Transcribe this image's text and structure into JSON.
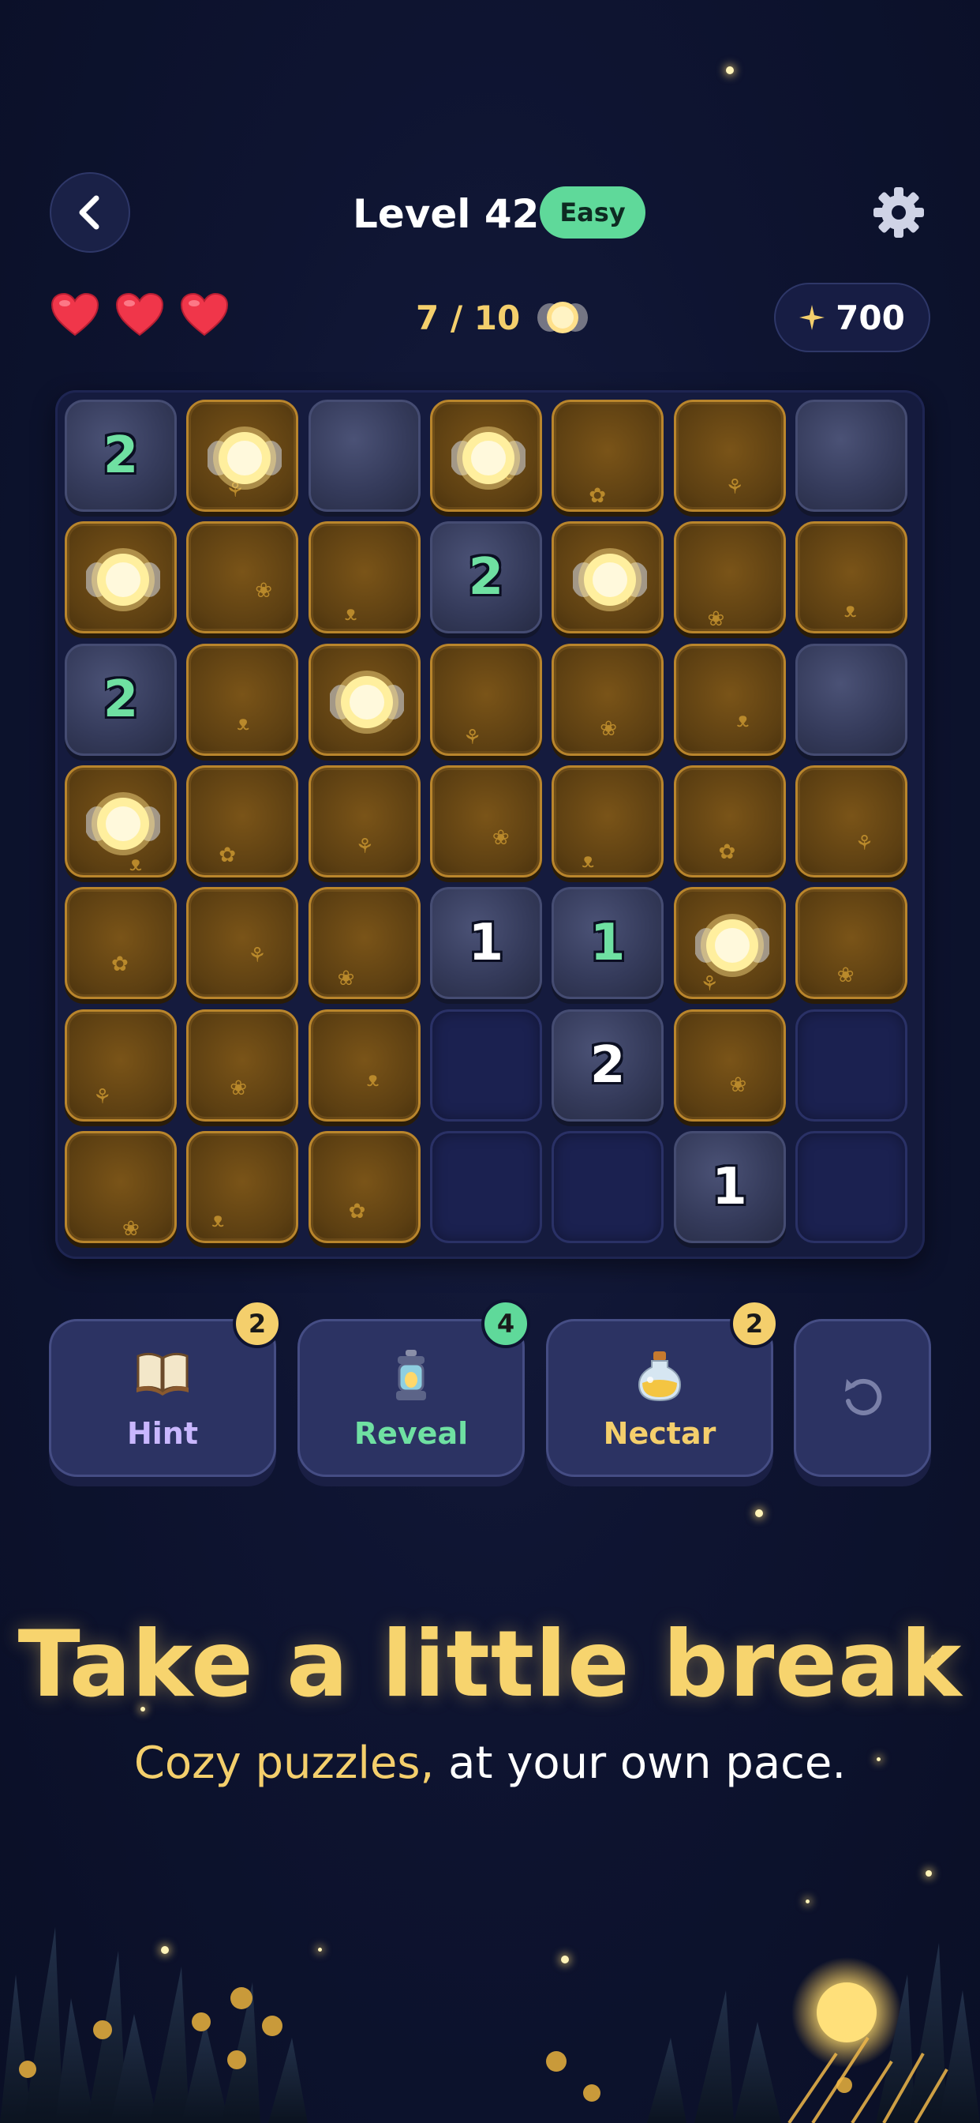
{
  "header": {
    "back_icon": "chevron-left-icon",
    "title": "Level 42",
    "difficulty": "Easy",
    "settings_icon": "gear-icon"
  },
  "status": {
    "lives": 3,
    "progress": "7 / 10",
    "coins": "700"
  },
  "board": {
    "rows": [
      [
        {
          "t": "stone",
          "n": "2",
          "c": "g"
        },
        {
          "t": "glow"
        },
        {
          "t": "stone"
        },
        {
          "t": "glow"
        },
        {
          "t": "dirt"
        },
        {
          "t": "dirt"
        },
        {
          "t": "stone"
        }
      ],
      [
        {
          "t": "glow"
        },
        {
          "t": "dirt"
        },
        {
          "t": "dirt"
        },
        {
          "t": "stone",
          "n": "2",
          "c": "g"
        },
        {
          "t": "glow"
        },
        {
          "t": "dirt"
        },
        {
          "t": "dirt"
        }
      ],
      [
        {
          "t": "stone",
          "n": "2",
          "c": "g"
        },
        {
          "t": "dirt"
        },
        {
          "t": "glow"
        },
        {
          "t": "dirt"
        },
        {
          "t": "dirt"
        },
        {
          "t": "dirt"
        },
        {
          "t": "stone"
        }
      ],
      [
        {
          "t": "glow"
        },
        {
          "t": "dirt"
        },
        {
          "t": "dirt"
        },
        {
          "t": "dirt"
        },
        {
          "t": "dirt"
        },
        {
          "t": "dirt"
        },
        {
          "t": "dirt"
        }
      ],
      [
        {
          "t": "dirt"
        },
        {
          "t": "dirt"
        },
        {
          "t": "dirt"
        },
        {
          "t": "stone",
          "n": "1",
          "c": "w"
        },
        {
          "t": "stone",
          "n": "1",
          "c": "g"
        },
        {
          "t": "glow"
        },
        {
          "t": "dirt"
        }
      ],
      [
        {
          "t": "dirt"
        },
        {
          "t": "dirt"
        },
        {
          "t": "dirt"
        },
        {
          "t": "empty"
        },
        {
          "t": "stone",
          "n": "2",
          "c": "w"
        },
        {
          "t": "dirt"
        },
        {
          "t": "empty"
        }
      ],
      [
        {
          "t": "dirt"
        },
        {
          "t": "dirt"
        },
        {
          "t": "dirt"
        },
        {
          "t": "empty"
        },
        {
          "t": "empty"
        },
        {
          "t": "stone",
          "n": "1",
          "c": "w"
        },
        {
          "t": "empty"
        }
      ]
    ]
  },
  "powerups": [
    {
      "label": "Hint",
      "count": "2",
      "icon": "book-icon",
      "label_color": "#c9b7ff",
      "badge_color": "#f4cf6c"
    },
    {
      "label": "Reveal",
      "count": "4",
      "icon": "lantern-icon",
      "label_color": "#6fe0a2",
      "badge_color": "#5fd99a"
    },
    {
      "label": "Nectar",
      "count": "2",
      "icon": "potion-icon",
      "label_color": "#f4cf6c",
      "badge_color": "#f4cf6c"
    }
  ],
  "undo_icon": "undo-icon",
  "promo": {
    "headline": "Take a little break",
    "sub_accent": "Cozy puzzles,",
    "sub_rest": " at your own pace."
  }
}
